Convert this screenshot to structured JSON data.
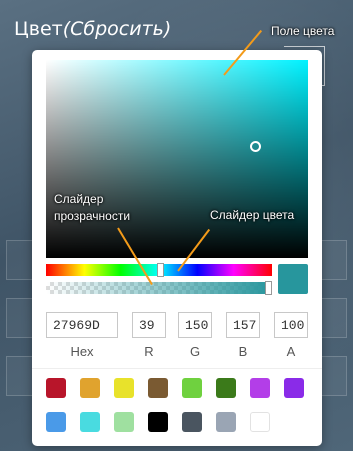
{
  "header": {
    "title": "Цвет",
    "reset_label": "(Сбросить)"
  },
  "picker": {
    "hue": 183,
    "alpha": 1.0,
    "current_color": "#27969D",
    "hex_value": "27969D",
    "r": "39",
    "g": "150",
    "b": "157",
    "a": "100",
    "labels": {
      "hex": "Hex",
      "r": "R",
      "g": "G",
      "b": "B",
      "a": "A"
    }
  },
  "palette": [
    "#b8152a",
    "#e0a32e",
    "#e8e22b",
    "#7a5a32",
    "#6fd13f",
    "#3b7a1a",
    "#b33ee8",
    "#8a2be8",
    "#4a9ae8",
    "#49dbe0",
    "#9fe0a0",
    "#000000",
    "#4a5560",
    "#9aa5b4",
    "#ffffff"
  ],
  "annotations": {
    "color_field": "Поле цвета",
    "alpha_slider": "Слайдер прозрачности",
    "hue_slider": "Слайдер цвета"
  }
}
